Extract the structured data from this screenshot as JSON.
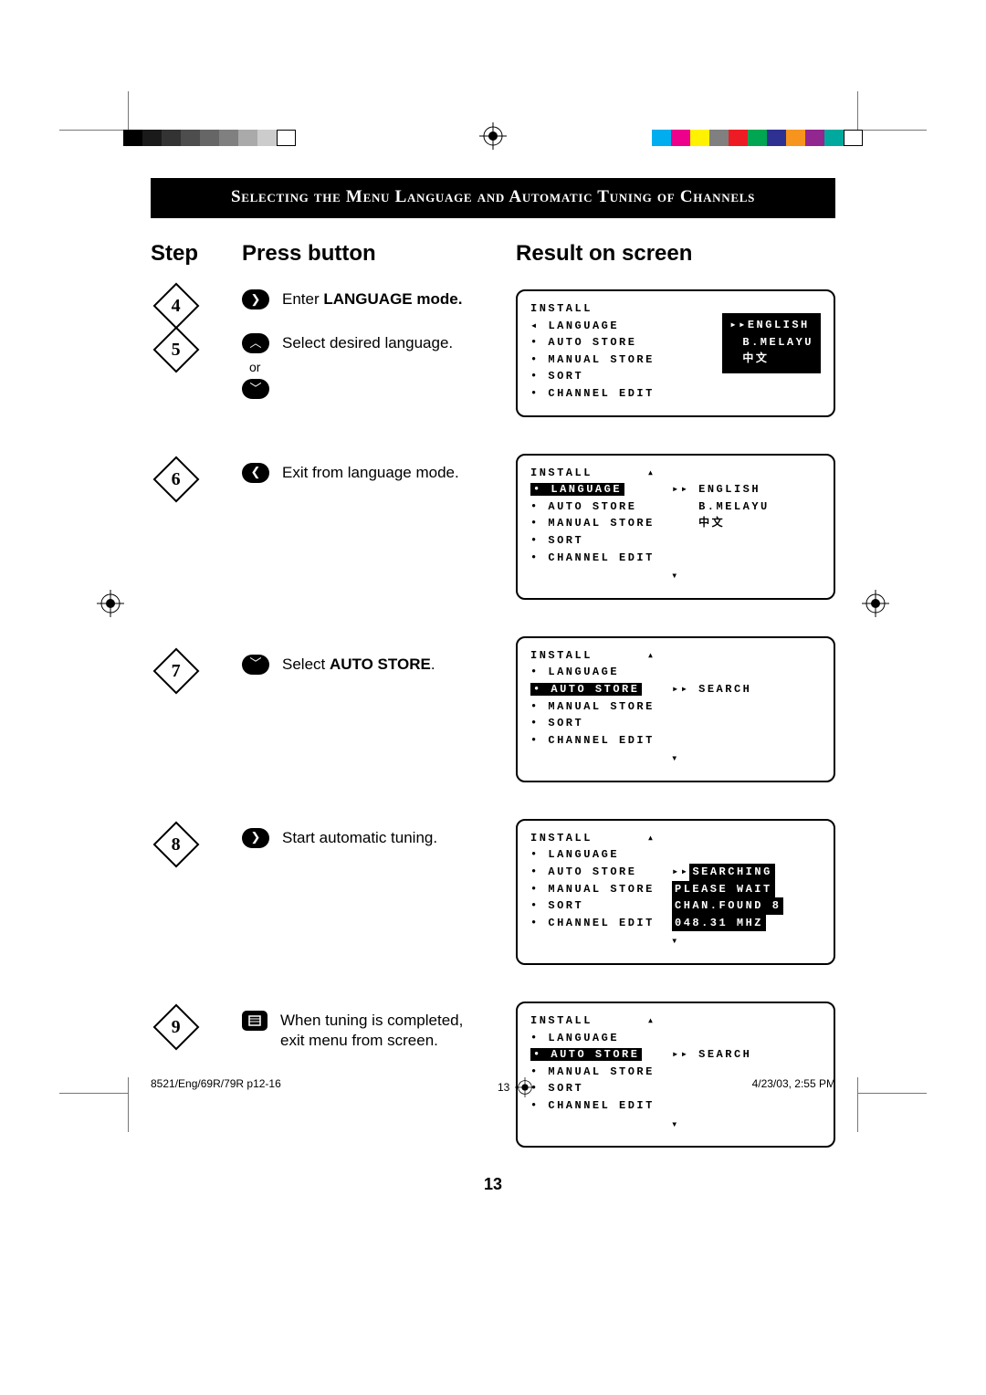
{
  "colorbars_left": [
    "#000000",
    "#1a1a1a",
    "#333333",
    "#4d4d4d",
    "#666666",
    "#808080",
    "#aaaaaa",
    "#cccccc",
    "#ffffff"
  ],
  "colorbars_right": [
    "#00aeef",
    "#ec008c",
    "#fff200",
    "#808080",
    "#ed1c24",
    "#00a651",
    "#2e3192",
    "#f7941d",
    "#92278f",
    "#00a99d",
    "#ffffff"
  ],
  "title": "Selecting the Menu Language  and Automatic Tuning of Channels",
  "headers": {
    "step": "Step",
    "press": "Press button",
    "result": "Result on screen"
  },
  "steps": {
    "s4": {
      "num": "4",
      "text_pre": "Enter ",
      "text_bold": "LANGUAGE mode."
    },
    "s5": {
      "num": "5",
      "text": "Select desired language.",
      "or": "or"
    },
    "s6": {
      "num": "6",
      "text": "Exit from language mode."
    },
    "s7": {
      "num": "7",
      "text_pre": "Select ",
      "text_bold": "AUTO STORE",
      "text_post": "."
    },
    "s8": {
      "num": "8",
      "text": "Start automatic tuning."
    },
    "s9": {
      "num": "9",
      "text1": "When tuning is completed,",
      "text2": "exit menu from screen."
    }
  },
  "osd": {
    "install": "INSTALL",
    "language": "LANGUAGE",
    "auto_store": "AUTO STORE",
    "manual_store": "MANUAL STORE",
    "sort": "SORT",
    "channel_edit": "CHANNEL EDIT",
    "english": "ENGLISH",
    "bmelayu": "B.MELAYU",
    "chinese": "中文",
    "search": "SEARCH",
    "searching": "SEARCHING",
    "please_wait": "PLEASE WAIT",
    "chan_found": "CHAN.FOUND 8",
    "mhz": "048.31 MHZ"
  },
  "page_number": "13",
  "footer": {
    "left": "8521/Eng/69R/79R p12-16",
    "center": "13",
    "right": "4/23/03, 2:55 PM"
  }
}
